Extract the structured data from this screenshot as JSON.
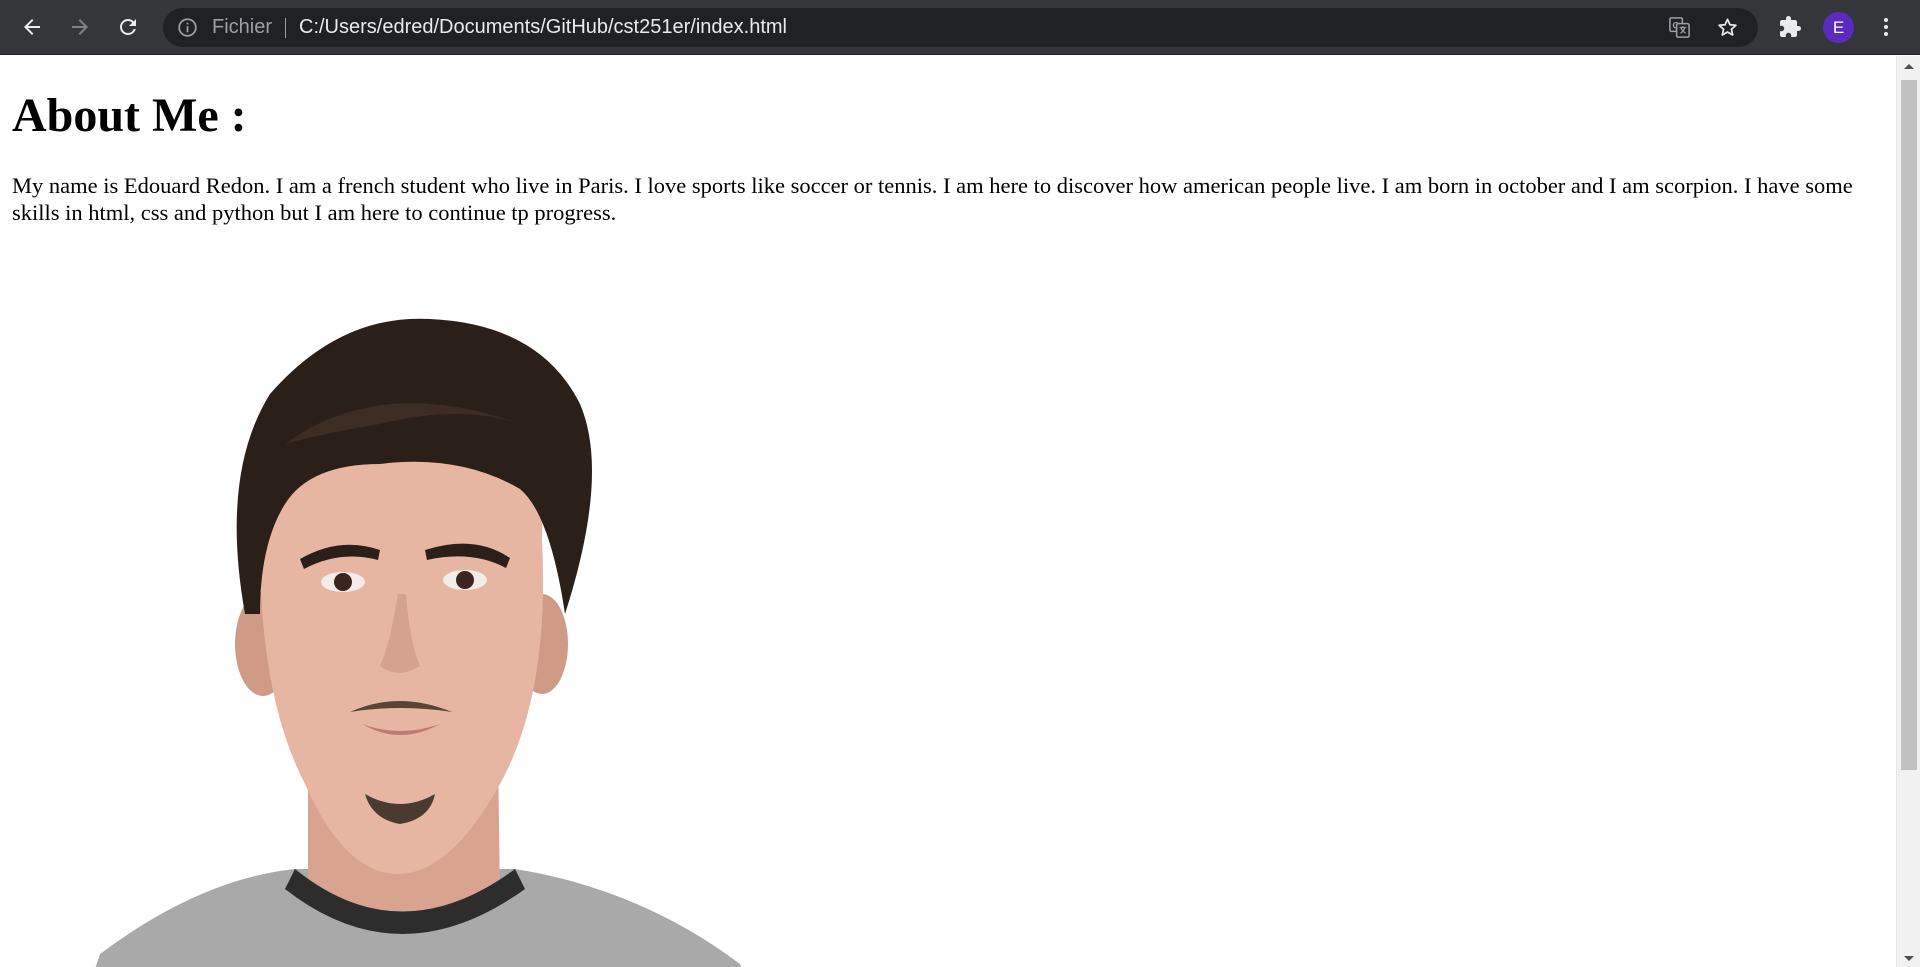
{
  "browser": {
    "omnibox": {
      "scheme_label": "Fichier",
      "url": "C:/Users/edred/Documents/GitHub/cst251er/index.html"
    },
    "profile_initial": "E",
    "accent_color": "#5b2bc0",
    "toolbar_color": "#35363a",
    "icons": [
      "back-arrow-icon",
      "forward-arrow-icon",
      "reload-icon",
      "info-icon",
      "translate-icon",
      "star-icon",
      "extensions-puzzle-icon",
      "kebab-menu-icon"
    ]
  },
  "page": {
    "heading": "About Me :",
    "bio": "My name is Edouard Redon. I am a french student who live in Paris. I love sports like soccer or tennis. I am here to discover how american people live. I am born in october and I am scorpion. I have some skills in html, css and python but I am here to continue tp progress."
  }
}
